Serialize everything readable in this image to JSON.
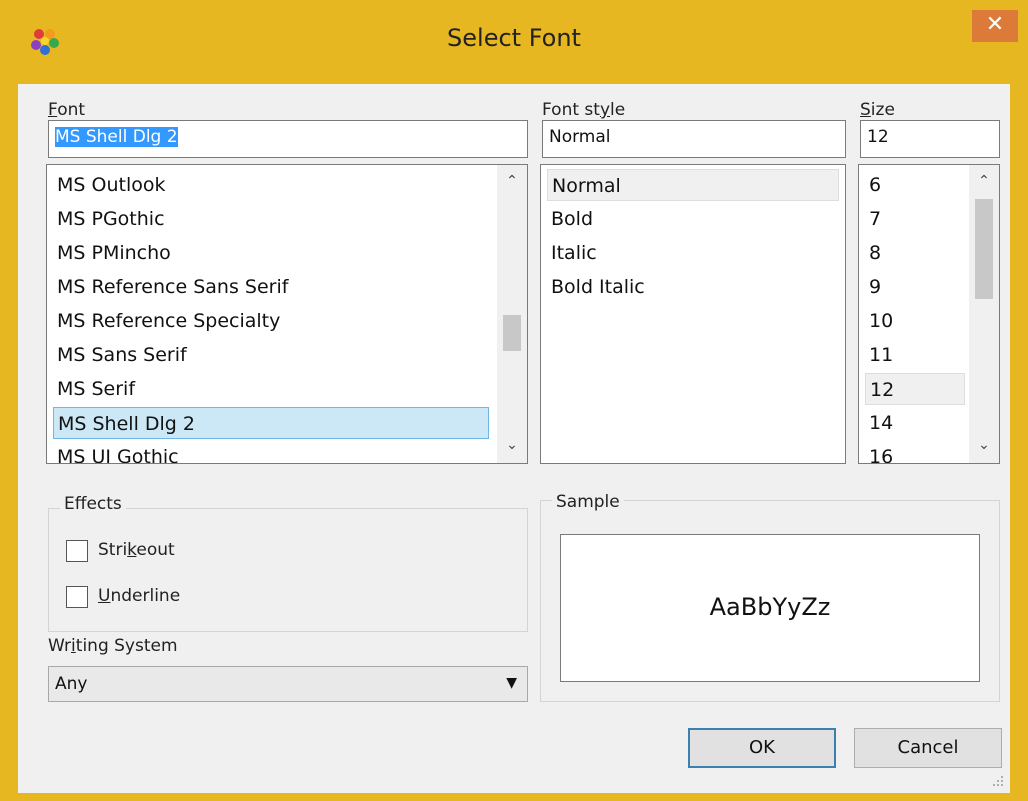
{
  "window": {
    "title": "Select Font",
    "close_glyph": "✕",
    "icon": "app-logo-icon"
  },
  "font": {
    "label": "Font",
    "value": "MS Shell Dlg 2",
    "items": [
      "MS Outlook",
      "MS PGothic",
      "MS PMincho",
      "MS Reference Sans Serif",
      "MS Reference Specialty",
      "MS Sans Serif",
      "MS Serif",
      "MS Shell Dlg 2",
      "MS UI Gothic"
    ],
    "selected": "MS Shell Dlg 2"
  },
  "style": {
    "label": "Font style",
    "value": "Normal",
    "items": [
      "Normal",
      "Bold",
      "Italic",
      "Bold Italic"
    ],
    "selected": "Normal"
  },
  "size": {
    "label": "Size",
    "value": "12",
    "items": [
      "6",
      "7",
      "8",
      "9",
      "10",
      "11",
      "12",
      "14",
      "16"
    ],
    "selected": "12"
  },
  "effects": {
    "label": "Effects",
    "strikeout_label": "Strikeout",
    "underline_label": "Underline",
    "strikeout_checked": false,
    "underline_checked": false
  },
  "writing_system": {
    "label": "Writing System",
    "value": "Any"
  },
  "sample": {
    "label": "Sample",
    "text": "AaBbYyZz"
  },
  "buttons": {
    "ok": "OK",
    "cancel": "Cancel"
  },
  "colors": {
    "title_bar": "#e7b721",
    "close": "#dc7a3a",
    "selection": "#cce8f6",
    "text_highlight": "#3399ff"
  }
}
